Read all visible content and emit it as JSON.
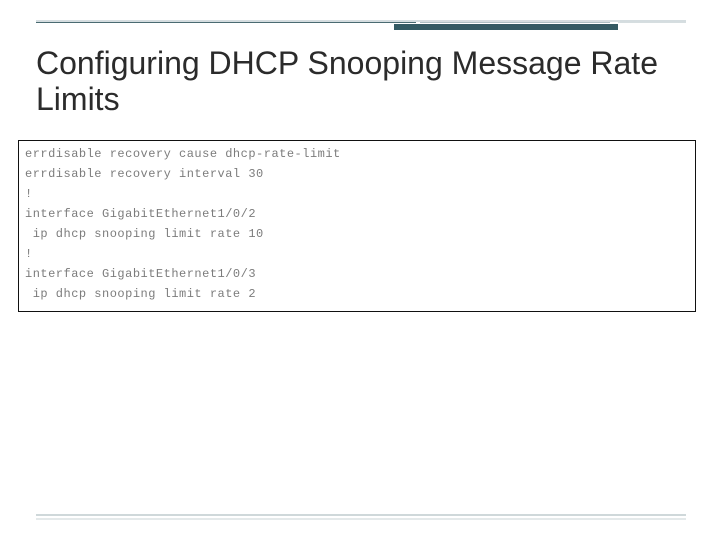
{
  "slide": {
    "title": "Configuring DHCP Snooping Message Rate Limits"
  },
  "code": {
    "lines": [
      "errdisable recovery cause dhcp-rate-limit",
      "errdisable recovery interval 30",
      "!",
      "interface GigabitEthernet1/0/2",
      " ip dhcp snooping limit rate 10",
      "!",
      "interface GigabitEthernet1/0/3",
      " ip dhcp snooping limit rate 2"
    ]
  }
}
